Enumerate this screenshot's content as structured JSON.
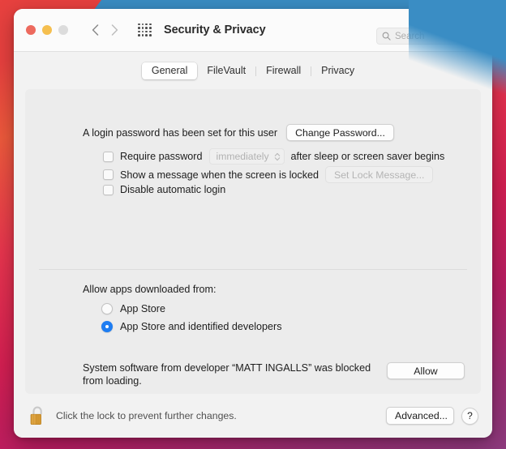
{
  "window": {
    "title": "Security & Privacy",
    "traffic_lights": [
      "close-red",
      "minimize-yellow",
      "zoom-gray"
    ],
    "nav": {
      "back_icon": "chevron-left-icon",
      "forward_icon": "chevron-right-icon"
    },
    "grid_icon": "app-grid-icon"
  },
  "search": {
    "icon": "search-icon",
    "placeholder": "Search",
    "value": ""
  },
  "tabs": [
    {
      "label": "General",
      "active": true
    },
    {
      "label": "FileVault",
      "active": false
    },
    {
      "label": "Firewall",
      "active": false
    },
    {
      "label": "Privacy",
      "active": false
    }
  ],
  "general": {
    "password_status": "A login password has been set for this user",
    "change_password_button": "Change Password...",
    "require_password": {
      "checked": false,
      "label_before": "Require password",
      "interval_value": "immediately",
      "interval_disabled": true,
      "label_after": "after sleep or screen saver begins"
    },
    "show_message": {
      "checked": false,
      "label": "Show a message when the screen is locked",
      "button": "Set Lock Message...",
      "button_disabled": true
    },
    "disable_auto_login": {
      "checked": false,
      "label": "Disable automatic login"
    },
    "allow_apps_label": "Allow apps downloaded from:",
    "allow_apps_options": [
      {
        "label": "App Store",
        "selected": false
      },
      {
        "label": "App Store and identified developers",
        "selected": true
      }
    ],
    "blocked_notice": "System software from developer “MATT INGALLS” was blocked from loading.",
    "allow_button": "Allow"
  },
  "bottom": {
    "lock_icon": "unlocked-padlock-icon",
    "lock_text": "Click the lock to prevent further changes.",
    "advanced_button": "Advanced...",
    "help_button": "?"
  },
  "colors": {
    "accent_blue": "#1e7df2",
    "panel": "#ececec",
    "window": "#f2f2f2",
    "lock_gold": "#d79a34"
  }
}
